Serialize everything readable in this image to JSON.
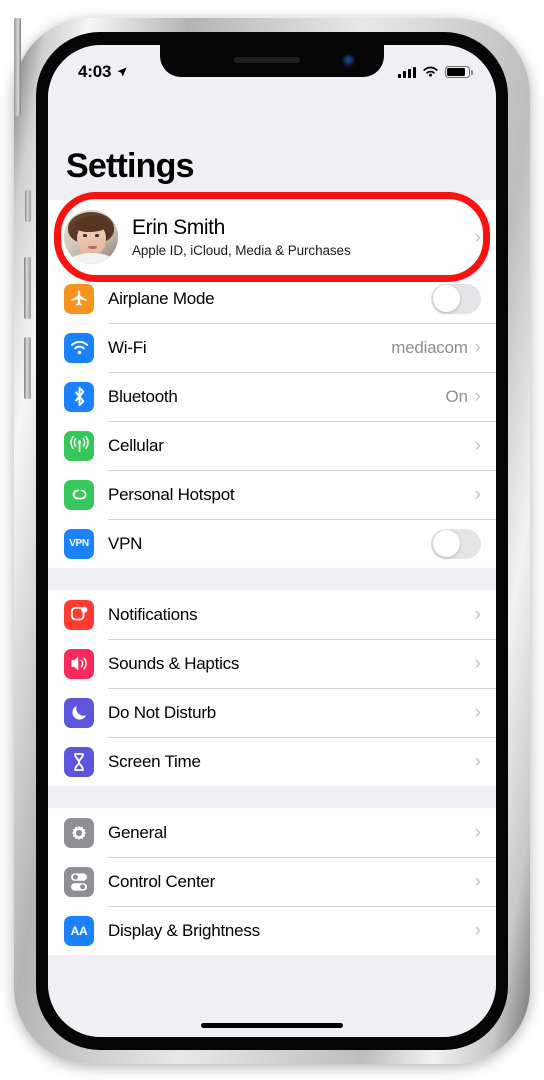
{
  "status_bar": {
    "time": "4:03",
    "location_icon": "location-arrow-icon",
    "signal_icon": "cellular-signal-icon",
    "wifi_icon": "wifi-icon",
    "battery_icon": "battery-icon"
  },
  "header": {
    "title": "Settings"
  },
  "profile": {
    "name": "Erin Smith",
    "subtitle": "Apple ID, iCloud, Media & Purchases",
    "avatar": "user-avatar-photo",
    "chevron": "›",
    "highlight_color": "#fc1111"
  },
  "groups": [
    {
      "id": "connectivity",
      "rows": [
        {
          "label": "Airplane Mode",
          "icon": "airplane-icon",
          "icon_color": "#f7931e",
          "accessory": "toggle",
          "toggle_on": false
        },
        {
          "label": "Wi-Fi",
          "icon": "wifi-icon",
          "icon_color": "#1a82ff",
          "accessory": "value",
          "value": "mediacom",
          "chevron": "›"
        },
        {
          "label": "Bluetooth",
          "icon": "bluetooth-icon",
          "icon_color": "#1a82ff",
          "accessory": "value",
          "value": "On",
          "chevron": "›"
        },
        {
          "label": "Cellular",
          "icon": "cellular-antenna-icon",
          "icon_color": "#34c759",
          "accessory": "chevron",
          "value": "",
          "chevron": "›"
        },
        {
          "label": "Personal Hotspot",
          "icon": "hotspot-link-icon",
          "icon_color": "#34c759",
          "accessory": "chevron",
          "value": "",
          "chevron": "›"
        },
        {
          "label": "VPN",
          "icon": "vpn-badge-icon",
          "icon_color": "#1a82ff",
          "accessory": "toggle",
          "toggle_on": false
        }
      ]
    },
    {
      "id": "alerts",
      "rows": [
        {
          "label": "Notifications",
          "icon": "notifications-icon",
          "icon_color": "#ff3b30",
          "accessory": "chevron",
          "value": "",
          "chevron": "›"
        },
        {
          "label": "Sounds & Haptics",
          "icon": "speaker-icon",
          "icon_color": "#fa2a5a",
          "accessory": "chevron",
          "value": "",
          "chevron": "›"
        },
        {
          "label": "Do Not Disturb",
          "icon": "moon-icon",
          "icon_color": "#5d55dd",
          "accessory": "chevron",
          "value": "",
          "chevron": "›"
        },
        {
          "label": "Screen Time",
          "icon": "hourglass-icon",
          "icon_color": "#5d55dd",
          "accessory": "chevron",
          "value": "",
          "chevron": "›"
        }
      ]
    },
    {
      "id": "system",
      "rows": [
        {
          "label": "General",
          "icon": "gear-icon",
          "icon_color": "#8e8e93",
          "accessory": "chevron",
          "value": "",
          "chevron": "›"
        },
        {
          "label": "Control Center",
          "icon": "control-center-icon",
          "icon_color": "#8e8e93",
          "accessory": "chevron",
          "value": "",
          "chevron": "›"
        },
        {
          "label": "Display & Brightness",
          "icon": "display-aa-icon",
          "icon_color": "#1a82ff",
          "accessory": "chevron",
          "value": "",
          "chevron": "›"
        }
      ]
    }
  ]
}
